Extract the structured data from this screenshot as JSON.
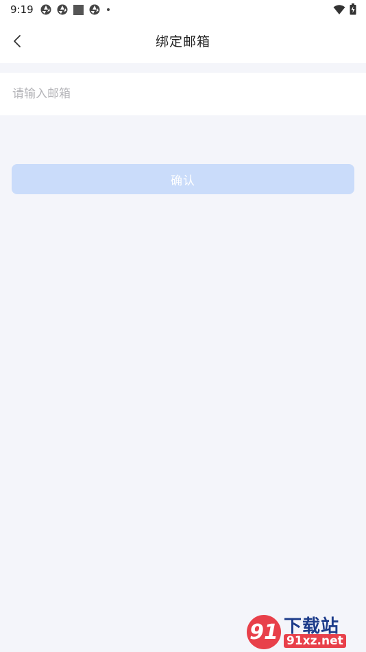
{
  "status_bar": {
    "time": "9:19",
    "left_icons": [
      "aperture-icon",
      "aperture-icon",
      "square-icon",
      "aperture-icon",
      "dot-icon"
    ],
    "right_icons": [
      "wifi-icon",
      "battery-icon"
    ]
  },
  "header": {
    "title": "绑定邮箱",
    "back_icon": "chevron-left-icon"
  },
  "form": {
    "email_value": "",
    "email_placeholder": "请输入邮箱",
    "confirm_label": "确认"
  },
  "watermark": {
    "logo_text": "91",
    "name": "下载站",
    "url": "91xz.net"
  },
  "colors": {
    "background": "#f4f5fa",
    "button_disabled": "#cadcfa",
    "watermark_red": "#e8404a",
    "watermark_blue": "#1d3c8a"
  }
}
